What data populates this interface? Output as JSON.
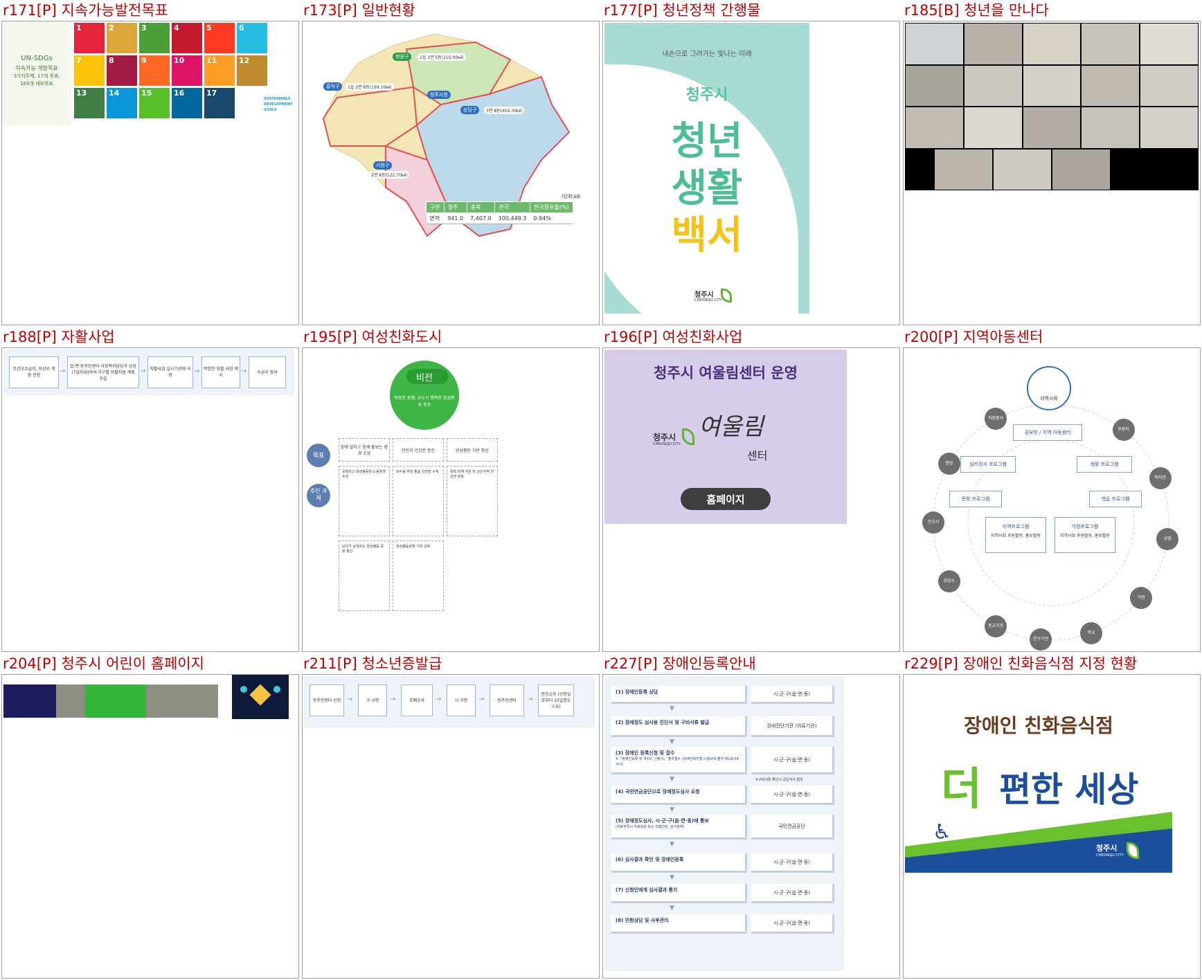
{
  "panels": [
    {
      "caption": "r171[P] 지속가능발전목표"
    },
    {
      "caption": "r173[P] 일반현황"
    },
    {
      "caption": "r177[P] 청년정책 간행물"
    },
    {
      "caption": "r185[B] 청년을 만나다"
    },
    {
      "caption": "r188[P] 자활사업"
    },
    {
      "caption": "r195[P] 여성친화도시"
    },
    {
      "caption": "r196[P] 여성친화사업"
    },
    {
      "caption": "r200[P] 지역아동센터"
    },
    {
      "caption": "r204[P] 청주시 어린이 홈페이지"
    },
    {
      "caption": "r211[P] 청소년증발급"
    },
    {
      "caption": "r227[P] 장애인등록안내"
    },
    {
      "caption": "r229[P] 장애인 친화음식점 지정 현황"
    }
  ],
  "sdg": {
    "title1": "UN-SDGs",
    "title2": "지속가능 개발목표",
    "title3": "3가지주제, 17개 목표,",
    "title4": "169개 세부목표",
    "colors": [
      "#e5243b",
      "#dda63a",
      "#4c9f38",
      "#c5192d",
      "#ff3a21",
      "#26bde2",
      "#fcc30b",
      "#a21942",
      "#fd6925",
      "#dd1367",
      "#fd9d24",
      "#bf8b2e",
      "#3f7e44",
      "#0a97d9",
      "#56c02b",
      "#00689d",
      "#19486a"
    ],
    "numbers": [
      "1",
      "2",
      "3",
      "4",
      "5",
      "6",
      "7",
      "8",
      "9",
      "10",
      "11",
      "12",
      "13",
      "14",
      "15",
      "16",
      "17"
    ],
    "goals_label": "SUSTAINABLE DEVELOPMENT GOALS"
  },
  "map": {
    "unit": "(단위:㎢)",
    "districts": [
      {
        "name": "청원구",
        "detail": "2읍 1면 5동(215.00㎢)",
        "color": "#3aa64f"
      },
      {
        "name": "흥덕구",
        "detail": "1읍 2면 8동(199.10㎢)",
        "color": "#3a7ac7"
      },
      {
        "name": "상당구",
        "detail": "5면 8동(404.30㎢)",
        "color": "#3a7ac7"
      },
      {
        "name": "서원구",
        "detail": "2면 8동(122.70㎢)",
        "color": "#3a7ac7"
      }
    ],
    "cityhall": "청주시청",
    "headers": [
      "구분",
      "청주",
      "충북",
      "전국",
      "전국점유율(%)"
    ],
    "row": [
      "면적",
      "941.0",
      "7,407.0",
      "100,449.3",
      "0.94%"
    ]
  },
  "youth": {
    "subtitle": "내손으로 그려가는 빛나는 미래",
    "city": "청주시",
    "line1": "청년",
    "line2": "생활",
    "line3": "백서",
    "logo": "청주시",
    "logo_sub": "CHEONGJU CITY"
  },
  "selfsupport": {
    "steps": [
      "조건부수급자, 차상위 계층 선정",
      "읍·면·동주민센터 사회복지담당과 상담(7일이내)하여 가구별 자활지원 계획 수립",
      "자활사업 실시기관에 의뢰",
      "적합한 자활 사업 제시",
      "수급자 참여"
    ]
  },
  "women": {
    "vision": "비전",
    "vision_text": "따뜻한 동행, 모두가 행복한 양성평등 청주",
    "goal_label": "목표",
    "task_label": "추진 과제",
    "goals": [
      "함께 일하고 함께 돌보는 환경 조성",
      "안전과 건강권 증진",
      "양성평등 기반 확산"
    ],
    "tasks": [
      "공정하고 양성평등한 노동환경 조성",
      "모두를 위한 돌봄 안전망 구축",
      "폭력 피해 지원 및 성인지적 건강권 보장",
      "남녀가 상생하는 양성평등 문화 확산",
      "양성평등정책 기반 강화"
    ]
  },
  "yeoulrim": {
    "title": "청주시 여울림센터 운영",
    "logo": "청주시",
    "logo_sub": "CHEONGJU CITY",
    "script": "여울림",
    "center": "센터",
    "button": "홈페이지"
  },
  "childcenter": {
    "community": "지역사회",
    "hub": "공부방 / 지역 아동센터",
    "programs": [
      "심리정서 프로그램",
      "생활 프로그램",
      "문화 프로그램",
      "학습 프로그램"
    ],
    "program_local": "지역프로그램",
    "program_local_sub": "지역사회 후원활동, 홍보활동",
    "program_family": "가정프로그램",
    "program_family_sub": "지역사회 후원활동, 홍보활동",
    "nodes": [
      "자원봉사",
      "후원자",
      "복지관",
      "상점",
      "가정",
      "학교",
      "연구기관",
      "종교기관",
      "상담소",
      "관공서",
      "병원"
    ]
  },
  "kids": {
    "colors": [
      "#1c1c5e",
      "#8e8e82",
      "#35b53a",
      "#8e8e82"
    ]
  },
  "idcard": {
    "steps": [
      "동주민센터 신청",
      "구·시청",
      "조폐공사",
      "시·구청",
      "동주민센터",
      "본인교부 (신청일로부터 15일정도 소요)"
    ]
  },
  "disability": {
    "steps": [
      {
        "left": "(1) 장애인등록 상담",
        "right": "시·군·구(읍·면·동)"
      },
      {
        "left": "(2) 장애정도 심사용 진단서 및 구비서류 발급",
        "right": "장애진단기관 (의료기관)"
      },
      {
        "left": "(3) 장애인 등록신청 및 접수",
        "right": "시·군·구(읍·면·동)"
      },
      {
        "left": "(4) 국민연금공단으로 장애정도심사 요청",
        "right": "시·군·구(읍·면·동)"
      },
      {
        "left": "(5) 장애정도심사, 시·군·구(읍·면·동)에 통보",
        "right": "국민연금공단"
      },
      {
        "left": "(6) 심사결과 확인 및 장애인등록",
        "right": "시·군·구(읍·면·동)"
      },
      {
        "left": "(7) 신청인에게 심사결과 통지",
        "right": "시·군·구(읍·면·동)"
      },
      {
        "left": "(8) 민원상담 및 사후관리",
        "right": "시·군·구(읍·면·동)"
      }
    ],
    "note3": "※「장애인등록 및 서비스 신청서」 필수접수 (장애인복지법 시행규칙 별지 제1호의4 서식)",
    "note3b": "※구비서류 확인시 공단지사 협조",
    "note5": "(자료부족시 자료보완 또는 직접진단, 심사판여)"
  },
  "restaurant": {
    "arc": "장애인 친화음식점",
    "slogan_a": "더",
    "slogan_b": "편한 세상",
    "logo": "청주시",
    "logo_sub": "CHEONGJU CITY"
  }
}
